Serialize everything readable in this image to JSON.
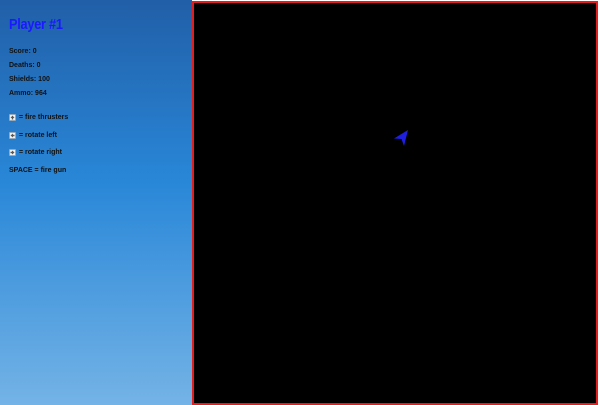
{
  "player": {
    "title": "Player #1"
  },
  "stats": {
    "score": "Score: 0",
    "deaths": "Deaths: 0",
    "shields": "Shields: 100",
    "ammo": "Ammo: 964"
  },
  "controls": {
    "thrusters": "= fire thrusters",
    "rotate_left": "= rotate left",
    "rotate_right": "= rotate right",
    "fire_gun": "SPACE = fire gun"
  },
  "icons": {
    "up_key": "arrow-up-key-icon",
    "left_key": "arrow-left-key-icon",
    "right_key": "arrow-right-key-icon",
    "ship": "player-ship-icon"
  },
  "colors": {
    "title": "#1a1aff",
    "arena_border": "#e02020",
    "arena_bg": "#000000",
    "ship": "#1f1fe0"
  }
}
